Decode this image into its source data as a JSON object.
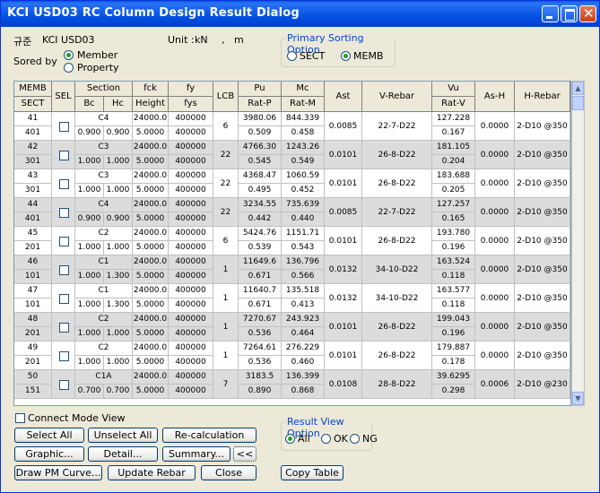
{
  "window": {
    "title": "KCI USD03 RC Column Design Result Dialog"
  },
  "header": {
    "code_label": "규준",
    "code_value": "KCI USD03",
    "unit_label": "Unit :",
    "unit_force": "kN",
    "unit_sep": ",",
    "unit_length": "m",
    "sorted_by": "Sored by",
    "sort_member": "Member",
    "sort_property": "Property",
    "primary_title": "Primary Sorting Option",
    "primary_sect": "SECT",
    "primary_memb": "MEMB"
  },
  "table": {
    "headers": {
      "memb": "MEMB",
      "sect": "SECT",
      "sel": "SEL",
      "section": "Section",
      "bc": "Bc",
      "hc": "Hc",
      "fck": "fck",
      "height": "Height",
      "fy": "fy",
      "fys": "fys",
      "lcb": "LCB",
      "pu": "Pu",
      "ratp": "Rat-P",
      "mc": "Mc",
      "ratm": "Rat-M",
      "ast": "Ast",
      "vrebar": "V-Rebar",
      "vu": "Vu",
      "ratv": "Rat-V",
      "ash": "As-H",
      "hrebar": "H-Rebar"
    },
    "rows": [
      {
        "memb": "41",
        "sect": "401",
        "name": "C4",
        "bc": "0.900",
        "hc": "0.900",
        "fck": "24000.0",
        "height": "5.0000",
        "fy": "400000",
        "fys": "400000",
        "lcb": "6",
        "pu": "3980.06",
        "ratp": "0.509",
        "mc": "844.339",
        "ratm": "0.458",
        "ast": "0.0085",
        "vrebar": "22-7-D22",
        "vu": "127.228",
        "ratv": "0.167",
        "ash": "0.0000",
        "hrebar": "2-D10 @350"
      },
      {
        "memb": "42",
        "sect": "301",
        "name": "C3",
        "bc": "1.000",
        "hc": "1.000",
        "fck": "24000.0",
        "height": "5.0000",
        "fy": "400000",
        "fys": "400000",
        "lcb": "22",
        "pu": "4766.30",
        "ratp": "0.545",
        "mc": "1243.26",
        "ratm": "0.549",
        "ast": "0.0101",
        "vrebar": "26-8-D22",
        "vu": "181.105",
        "ratv": "0.204",
        "ash": "0.0000",
        "hrebar": "2-D10 @350"
      },
      {
        "memb": "43",
        "sect": "301",
        "name": "C3",
        "bc": "1.000",
        "hc": "1.000",
        "fck": "24000.0",
        "height": "5.0000",
        "fy": "400000",
        "fys": "400000",
        "lcb": "22",
        "pu": "4368.47",
        "ratp": "0.495",
        "mc": "1060.59",
        "ratm": "0.452",
        "ast": "0.0101",
        "vrebar": "26-8-D22",
        "vu": "183.688",
        "ratv": "0.205",
        "ash": "0.0000",
        "hrebar": "2-D10 @350"
      },
      {
        "memb": "44",
        "sect": "401",
        "name": "C4",
        "bc": "0.900",
        "hc": "0.900",
        "fck": "24000.0",
        "height": "5.0000",
        "fy": "400000",
        "fys": "400000",
        "lcb": "22",
        "pu": "3234.55",
        "ratp": "0.442",
        "mc": "735.639",
        "ratm": "0.440",
        "ast": "0.0085",
        "vrebar": "22-7-D22",
        "vu": "127.257",
        "ratv": "0.165",
        "ash": "0.0000",
        "hrebar": "2-D10 @350"
      },
      {
        "memb": "45",
        "sect": "201",
        "name": "C2",
        "bc": "1.000",
        "hc": "1.000",
        "fck": "24000.0",
        "height": "5.0000",
        "fy": "400000",
        "fys": "400000",
        "lcb": "6",
        "pu": "5424.76",
        "ratp": "0.539",
        "mc": "1151.71",
        "ratm": "0.543",
        "ast": "0.0101",
        "vrebar": "26-8-D22",
        "vu": "193.780",
        "ratv": "0.196",
        "ash": "0.0000",
        "hrebar": "2-D10 @350"
      },
      {
        "memb": "46",
        "sect": "101",
        "name": "C1",
        "bc": "1.000",
        "hc": "1.300",
        "fck": "24000.0",
        "height": "5.0000",
        "fy": "400000",
        "fys": "400000",
        "lcb": "1",
        "pu": "11649.6",
        "ratp": "0.671",
        "mc": "136.796",
        "ratm": "0.566",
        "ast": "0.0132",
        "vrebar": "34-10-D22",
        "vu": "163.524",
        "ratv": "0.118",
        "ash": "0.0000",
        "hrebar": "2-D10 @350"
      },
      {
        "memb": "47",
        "sect": "101",
        "name": "C1",
        "bc": "1.000",
        "hc": "1.300",
        "fck": "24000.0",
        "height": "5.0000",
        "fy": "400000",
        "fys": "400000",
        "lcb": "1",
        "pu": "11640.7",
        "ratp": "0.671",
        "mc": "135.518",
        "ratm": "0.413",
        "ast": "0.0132",
        "vrebar": "34-10-D22",
        "vu": "163.577",
        "ratv": "0.118",
        "ash": "0.0000",
        "hrebar": "2-D10 @350"
      },
      {
        "memb": "48",
        "sect": "201",
        "name": "C2",
        "bc": "1.000",
        "hc": "1.000",
        "fck": "24000.0",
        "height": "5.0000",
        "fy": "400000",
        "fys": "400000",
        "lcb": "1",
        "pu": "7270.67",
        "ratp": "0.536",
        "mc": "243.923",
        "ratm": "0.464",
        "ast": "0.0101",
        "vrebar": "26-8-D22",
        "vu": "199.043",
        "ratv": "0.196",
        "ash": "0.0000",
        "hrebar": "2-D10 @350"
      },
      {
        "memb": "49",
        "sect": "201",
        "name": "C2",
        "bc": "1.000",
        "hc": "1.000",
        "fck": "24000.0",
        "height": "5.0000",
        "fy": "400000",
        "fys": "400000",
        "lcb": "1",
        "pu": "7264.61",
        "ratp": "0.536",
        "mc": "276.229",
        "ratm": "0.460",
        "ast": "0.0101",
        "vrebar": "26-8-D22",
        "vu": "179.887",
        "ratv": "0.178",
        "ash": "0.0000",
        "hrebar": "2-D10 @350"
      },
      {
        "memb": "50",
        "sect": "151",
        "name": "C1A",
        "bc": "0.700",
        "hc": "0.700",
        "fck": "24000.0",
        "height": "5.0000",
        "fy": "400000",
        "fys": "400000",
        "lcb": "7",
        "pu": "3183.5",
        "ratp": "0.890",
        "mc": "136.399",
        "ratm": "0.868",
        "ast": "0.0108",
        "vrebar": "28-8-D22",
        "vu": "39.6295",
        "ratv": "0.298",
        "ash": "0.0006",
        "hrebar": "2-D10 @230"
      }
    ]
  },
  "footer": {
    "connect_mode": "Connect Mode View",
    "select_all": "Select All",
    "unselect_all": "Unselect All",
    "recalc": "Re-calculation",
    "graphic": "Graphic...",
    "detail": "Detail...",
    "summary": "Summary...",
    "collapse": "<<",
    "draw_pm": "Draw PM Curve...",
    "update_rebar": "Update Rebar",
    "close": "Close",
    "copy_table": "Copy Table",
    "result_title": "Result View Option",
    "opt_all": "All",
    "opt_ok": "OK",
    "opt_ng": "NG"
  }
}
